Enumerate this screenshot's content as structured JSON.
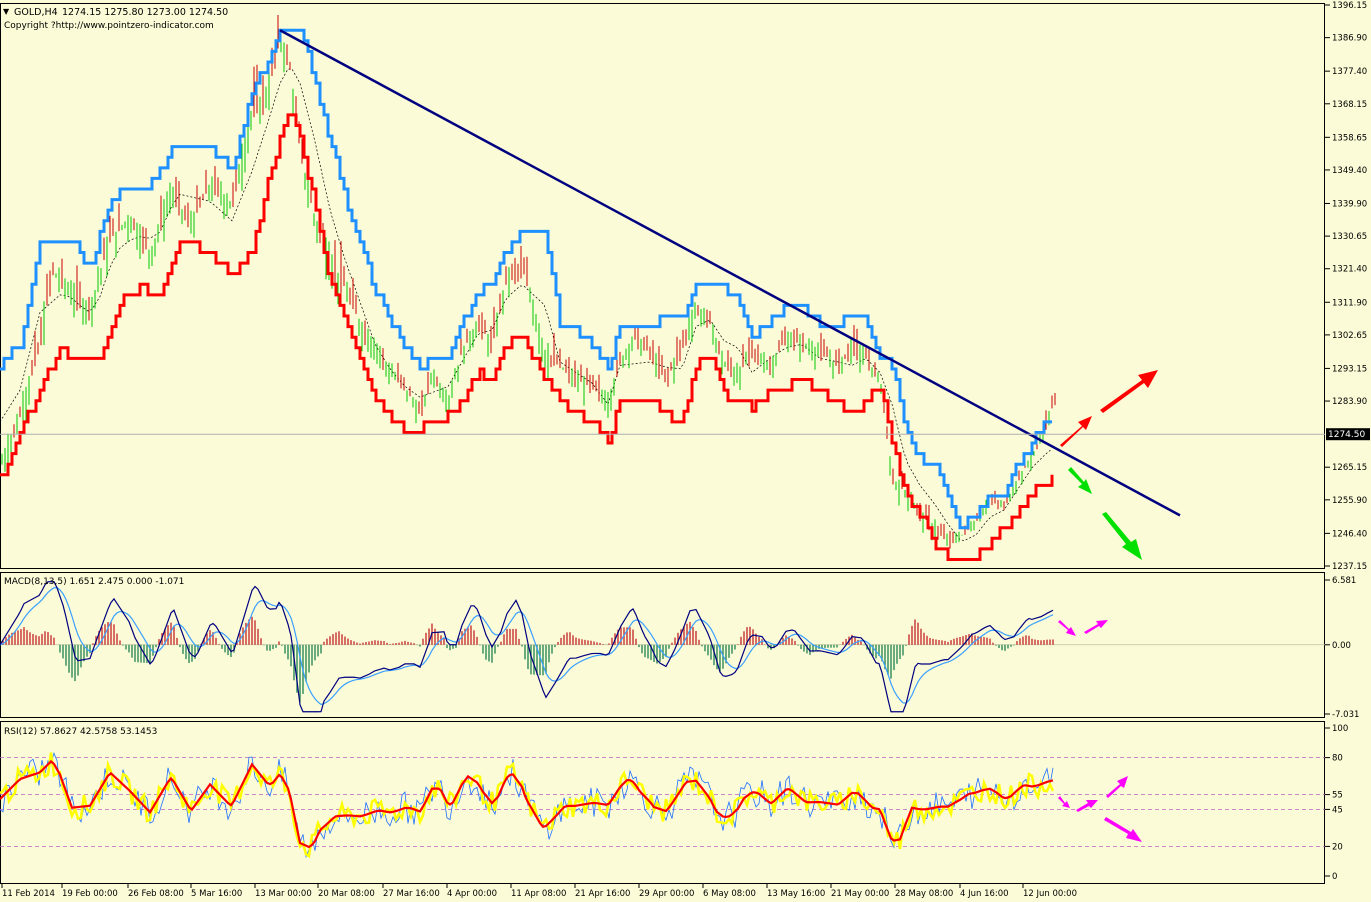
{
  "header": {
    "symbol": "GOLD,H4",
    "ohlc": "1274.15 1275.80 1273.00 1274.50",
    "copyright": "Copyright ?http://www.pointzero-indicator.com"
  },
  "colors": {
    "background": "#fbfbd7",
    "grid_text": "#000000",
    "trendline": "#000080",
    "upper_band": "#1e90ff",
    "lower_band": "#ff0000",
    "bull_candle": "#00c800",
    "bear_candle": "#c80000",
    "macd_line": "#000080",
    "signal_line": "#3aa0ff",
    "macd_hist_pos": "#c83232",
    "macd_hist_neg": "#2e8b57",
    "rsi_main": "#ff0000",
    "rsi_fast": "#ffff00",
    "rsi_slow": "#1e6fff",
    "arrow_up": "#ff0000",
    "arrow_down": "#00e000",
    "arrow_magenta": "#ff00ff"
  },
  "chart_data": [
    {
      "type": "line",
      "name": "price",
      "title": "GOLD,H4",
      "current_price_label": "1274.50",
      "current_price": 1274.5,
      "ylim": [
        1237.15,
        1396.15
      ],
      "y_ticks": [
        "1396.15",
        "1386.90",
        "1377.40",
        "1368.15",
        "1358.65",
        "1349.40",
        "1339.90",
        "1330.65",
        "1321.40",
        "1311.90",
        "1302.65",
        "1293.15",
        "1283.90",
        "1274.50",
        "1265.15",
        "1255.90",
        "1246.40",
        "1237.15"
      ],
      "x_labels": [
        "11 Feb 2014",
        "19 Feb 00:00",
        "26 Feb 08:00",
        "5 Mar 16:00",
        "13 Mar 00:00",
        "20 Mar 08:00",
        "27 Mar 16:00",
        "4 Apr 00:00",
        "11 Apr 08:00",
        "21 Apr 16:00",
        "29 Apr 00:00",
        "6 May 08:00",
        "13 May 16:00",
        "21 May 00:00",
        "28 May 08:00",
        "4 Jun 16:00",
        "12 Jun 00:00"
      ],
      "close_path": [
        [
          0,
          1265
        ],
        [
          20,
          1280
        ],
        [
          40,
          1300
        ],
        [
          52,
          1321
        ],
        [
          70,
          1315
        ],
        [
          90,
          1310
        ],
        [
          110,
          1330
        ],
        [
          130,
          1336
        ],
        [
          150,
          1326
        ],
        [
          172,
          1343
        ],
        [
          190,
          1334
        ],
        [
          210,
          1345
        ],
        [
          232,
          1340
        ],
        [
          252,
          1366
        ],
        [
          268,
          1372
        ],
        [
          280,
          1388
        ],
        [
          290,
          1378
        ],
        [
          300,
          1355
        ],
        [
          315,
          1335
        ],
        [
          330,
          1325
        ],
        [
          345,
          1316
        ],
        [
          360,
          1306
        ],
        [
          375,
          1300
        ],
        [
          390,
          1292
        ],
        [
          405,
          1288
        ],
        [
          420,
          1280
        ],
        [
          432,
          1292
        ],
        [
          448,
          1284
        ],
        [
          462,
          1298
        ],
        [
          478,
          1306
        ],
        [
          492,
          1300
        ],
        [
          506,
          1318
        ],
        [
          522,
          1322
        ],
        [
          532,
          1312
        ],
        [
          545,
          1298
        ],
        [
          560,
          1294
        ],
        [
          576,
          1290
        ],
        [
          592,
          1288
        ],
        [
          608,
          1284
        ],
        [
          620,
          1295
        ],
        [
          634,
          1302
        ],
        [
          650,
          1298
        ],
        [
          666,
          1290
        ],
        [
          682,
          1300
        ],
        [
          696,
          1310
        ],
        [
          710,
          1306
        ],
        [
          724,
          1294
        ],
        [
          738,
          1292
        ],
        [
          752,
          1298
        ],
        [
          770,
          1294
        ],
        [
          786,
          1302
        ],
        [
          802,
          1300
        ],
        [
          820,
          1298
        ],
        [
          838,
          1294
        ],
        [
          852,
          1300
        ],
        [
          866,
          1296
        ],
        [
          880,
          1290
        ],
        [
          892,
          1262
        ],
        [
          906,
          1258
        ],
        [
          920,
          1252
        ],
        [
          934,
          1248
        ],
        [
          948,
          1244
        ],
        [
          962,
          1246
        ],
        [
          976,
          1250
        ],
        [
          990,
          1256
        ],
        [
          1004,
          1254
        ],
        [
          1018,
          1262
        ],
        [
          1032,
          1268
        ],
        [
          1046,
          1278
        ],
        [
          1055,
          1284
        ]
      ],
      "upper_band_path": [
        [
          0,
          1294
        ],
        [
          20,
          1300
        ],
        [
          40,
          1330
        ],
        [
          70,
          1330
        ],
        [
          90,
          1322
        ],
        [
          110,
          1340
        ],
        [
          130,
          1345
        ],
        [
          150,
          1345
        ],
        [
          172,
          1355
        ],
        [
          210,
          1355
        ],
        [
          232,
          1350
        ],
        [
          252,
          1372
        ],
        [
          268,
          1380
        ],
        [
          280,
          1390
        ],
        [
          300,
          1390
        ],
        [
          315,
          1375
        ],
        [
          330,
          1358
        ],
        [
          345,
          1342
        ],
        [
          360,
          1328
        ],
        [
          375,
          1316
        ],
        [
          390,
          1306
        ],
        [
          405,
          1300
        ],
        [
          420,
          1294
        ],
        [
          448,
          1296
        ],
        [
          462,
          1306
        ],
        [
          478,
          1314
        ],
        [
          492,
          1318
        ],
        [
          506,
          1326
        ],
        [
          522,
          1332
        ],
        [
          545,
          1332
        ],
        [
          560,
          1306
        ],
        [
          576,
          1304
        ],
        [
          592,
          1300
        ],
        [
          608,
          1294
        ],
        [
          620,
          1304
        ],
        [
          650,
          1306
        ],
        [
          682,
          1308
        ],
        [
          696,
          1316
        ],
        [
          724,
          1316
        ],
        [
          738,
          1314
        ],
        [
          752,
          1302
        ],
        [
          770,
          1306
        ],
        [
          786,
          1310
        ],
        [
          802,
          1310
        ],
        [
          820,
          1306
        ],
        [
          838,
          1306
        ],
        [
          852,
          1308
        ],
        [
          866,
          1308
        ],
        [
          880,
          1296
        ],
        [
          892,
          1294
        ],
        [
          906,
          1276
        ],
        [
          920,
          1268
        ],
        [
          934,
          1266
        ],
        [
          948,
          1258
        ],
        [
          962,
          1248
        ],
        [
          976,
          1252
        ],
        [
          990,
          1258
        ],
        [
          1004,
          1258
        ],
        [
          1018,
          1266
        ],
        [
          1032,
          1272
        ],
        [
          1046,
          1278
        ],
        [
          1055,
          1278
        ]
      ],
      "lower_band_path": [
        [
          0,
          1262
        ],
        [
          20,
          1274
        ],
        [
          40,
          1288
        ],
        [
          60,
          1298
        ],
        [
          80,
          1296
        ],
        [
          100,
          1296
        ],
        [
          120,
          1312
        ],
        [
          140,
          1316
        ],
        [
          160,
          1314
        ],
        [
          180,
          1330
        ],
        [
          210,
          1326
        ],
        [
          232,
          1320
        ],
        [
          252,
          1326
        ],
        [
          268,
          1346
        ],
        [
          280,
          1358
        ],
        [
          290,
          1368
        ],
        [
          300,
          1358
        ],
        [
          315,
          1340
        ],
        [
          330,
          1318
        ],
        [
          345,
          1306
        ],
        [
          360,
          1296
        ],
        [
          375,
          1284
        ],
        [
          390,
          1280
        ],
        [
          405,
          1276
        ],
        [
          420,
          1276
        ],
        [
          448,
          1280
        ],
        [
          462,
          1284
        ],
        [
          478,
          1292
        ],
        [
          492,
          1290
        ],
        [
          506,
          1300
        ],
        [
          522,
          1302
        ],
        [
          545,
          1290
        ],
        [
          560,
          1284
        ],
        [
          576,
          1280
        ],
        [
          592,
          1278
        ],
        [
          608,
          1272
        ],
        [
          620,
          1284
        ],
        [
          650,
          1284
        ],
        [
          666,
          1280
        ],
        [
          682,
          1278
        ],
        [
          696,
          1294
        ],
        [
          710,
          1298
        ],
        [
          724,
          1286
        ],
        [
          738,
          1284
        ],
        [
          752,
          1282
        ],
        [
          770,
          1286
        ],
        [
          786,
          1288
        ],
        [
          802,
          1290
        ],
        [
          820,
          1286
        ],
        [
          838,
          1284
        ],
        [
          852,
          1280
        ],
        [
          866,
          1284
        ],
        [
          880,
          1288
        ],
        [
          892,
          1272
        ],
        [
          906,
          1258
        ],
        [
          920,
          1252
        ],
        [
          934,
          1244
        ],
        [
          948,
          1240
        ],
        [
          962,
          1240
        ],
        [
          976,
          1240
        ],
        [
          990,
          1244
        ],
        [
          1004,
          1248
        ],
        [
          1018,
          1252
        ],
        [
          1032,
          1258
        ],
        [
          1046,
          1260
        ],
        [
          1055,
          1264
        ]
      ],
      "trendline": {
        "x1": 280,
        "y1": 1389,
        "x2": 1180,
        "y2": 1251.5
      }
    },
    {
      "type": "line",
      "name": "macd",
      "title_text": "MACD(8,13,5) 1.651 2.475 0.000 -1.071",
      "y_ticks": [
        "6.581",
        "0.00",
        "-7.031"
      ],
      "ylim": [
        -7.031,
        6.581
      ]
    },
    {
      "type": "line",
      "name": "rsi",
      "title_text": "RSI(12) 57.8627 42.5758 53.1453",
      "y_ticks": [
        "100",
        "80",
        "55",
        "45",
        "20",
        "0"
      ],
      "levels": [
        80,
        55,
        45,
        20
      ],
      "ylim": [
        0,
        100
      ]
    }
  ]
}
